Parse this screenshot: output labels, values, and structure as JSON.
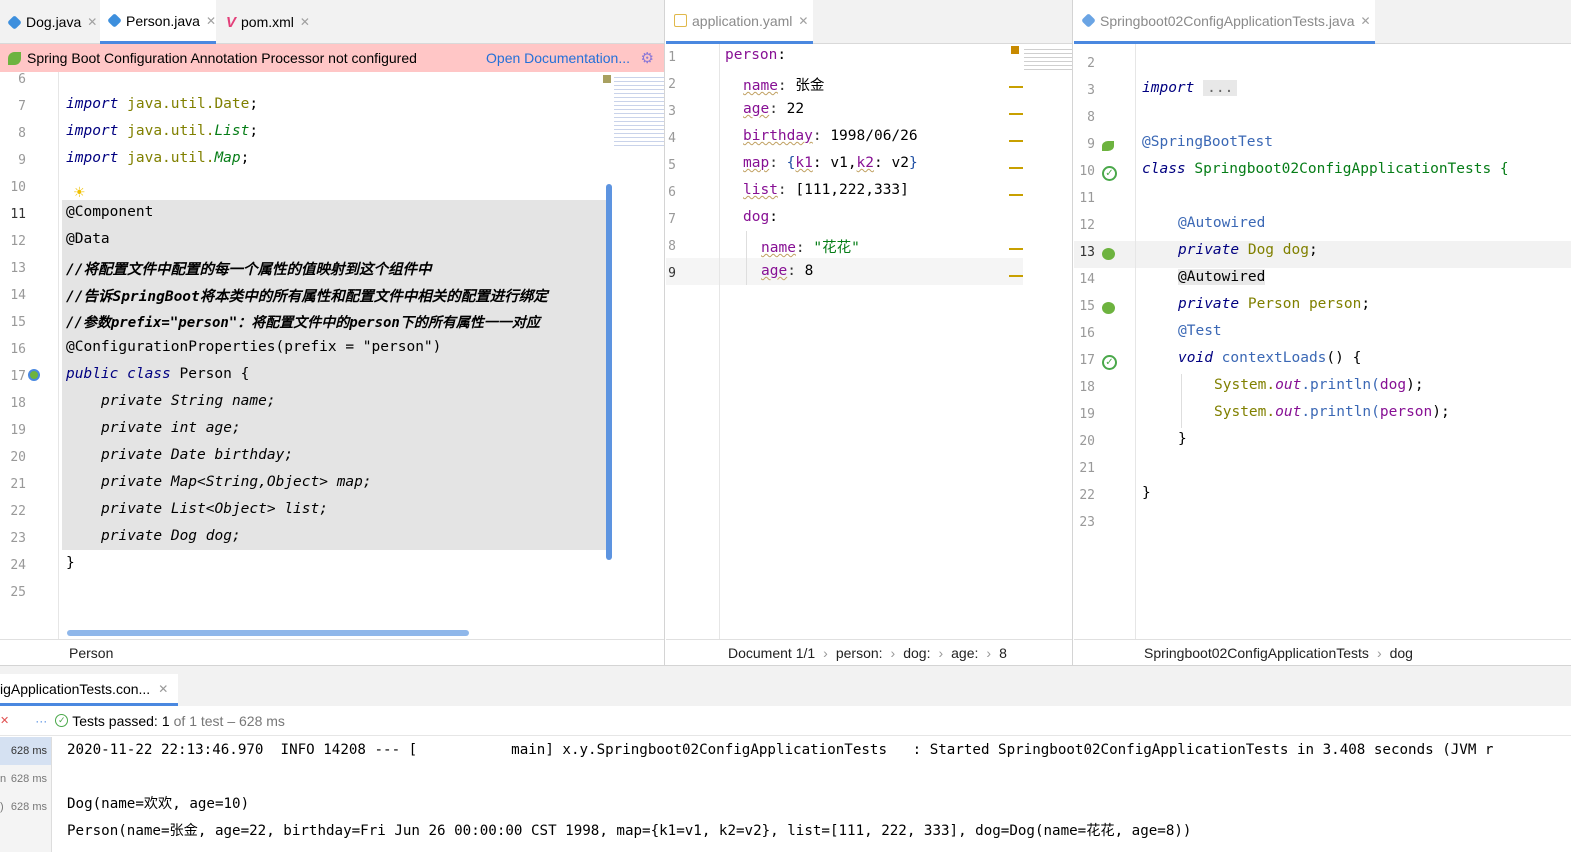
{
  "left_pane": {
    "tabs": [
      {
        "label": "Dog.java",
        "icon": "java-class-icon",
        "active": false
      },
      {
        "label": "Person.java",
        "icon": "java-class-icon",
        "active": true
      },
      {
        "label": "pom.xml",
        "icon": "maven-icon",
        "active": false
      }
    ],
    "banner": {
      "message": "Spring Boot Configuration Annotation Processor not configured",
      "link": "Open Documentation...",
      "color": "#ffc6c6"
    },
    "line_numbers": [
      "6",
      "7",
      "8",
      "9",
      "10",
      "11",
      "12",
      "13",
      "14",
      "15",
      "16",
      "17",
      "18",
      "19",
      "20",
      "21",
      "22",
      "23",
      "24",
      "25"
    ],
    "code": {
      "l7_kw": "import",
      "l7_pkg": "java.util.",
      "l7_cls": "Date",
      "l7_end": ";",
      "l8_kw": "import",
      "l8_pkg": "java.util.",
      "l8_cls": "List",
      "l8_end": ";",
      "l9_kw": "import",
      "l9_pkg": "java.util.",
      "l9_cls": "Map",
      "l9_end": ";",
      "l11": "@Component",
      "l12": "@Data",
      "l13": "//将配置文件中配置的每一个属性的值映射到这个组件中",
      "l14": "//告诉SpringBoot将本类中的所有属性和配置文件中相关的配置进行绑定",
      "l15": "//参数prefix=\"person\"：将配置文件中的person下的所有属性一一对应",
      "l16": "@ConfigurationProperties(prefix = \"person\")",
      "l17_kw": "public class",
      "l17_name": " Person {",
      "l18": "private String name;",
      "l19": "private int age;",
      "l20": "private Date birthday;",
      "l21": "private Map<String,Object> map;",
      "l22": "private List<Object> list;",
      "l23": "private Dog dog;",
      "l24": "}"
    },
    "breadcrumb": "Person"
  },
  "mid_pane": {
    "tab": {
      "label": "application.yaml",
      "icon": "yaml-icon"
    },
    "line_numbers": [
      "1",
      "2",
      "3",
      "4",
      "5",
      "6",
      "7",
      "8",
      "9"
    ],
    "yaml": {
      "person": "person",
      "name_k": "name",
      "name_v": "张金",
      "age_k": "age",
      "age_v": "22",
      "birthday_k": "birthday",
      "birthday_v": "1998/06/26",
      "map_k": "map",
      "map_v1k": "k1",
      "map_v1v": "v1",
      "map_v2k": "k2",
      "map_v2v": "v2",
      "list_k": "list",
      "list_v": "[111,222,333]",
      "dog_k": "dog",
      "dog_name_k": "name",
      "dog_name_v": "\"花花\"",
      "dog_age_k": "age",
      "dog_age_v": "8"
    },
    "breadcrumbs": [
      "Document 1/1",
      "person:",
      "dog:",
      "age:",
      "8"
    ]
  },
  "right_pane": {
    "tab": {
      "label": "Springboot02ConfigApplicationTests.java",
      "icon": "java-class-icon"
    },
    "line_numbers": [
      "2",
      "3",
      "8",
      "9",
      "10",
      "11",
      "12",
      "13",
      "14",
      "15",
      "16",
      "17",
      "18",
      "19",
      "20",
      "21",
      "22",
      "23"
    ],
    "code": {
      "l3_kw": "import",
      "l3_fold": "...",
      "l9": "@SpringBootTest",
      "l10_kw": "class",
      "l10_name": " Springboot02ConfigApplicationTests {",
      "l12": "@Autowired",
      "l13_kw": "private",
      "l13_type": " Dog ",
      "l13_field": "dog",
      "l13_end": ";",
      "l14": "@Autowired",
      "l15_kw": "private",
      "l15_type": " Person ",
      "l15_field": "person",
      "l15_end": ";",
      "l16": "@Test",
      "l17_kw": "void",
      "l17_name": " contextLoads",
      "l17_end": "() {",
      "l18_a": "System.",
      "l18_b": "out",
      "l18_c": ".println(",
      "l18_d": "dog",
      "l18_e": ");",
      "l19_a": "System.",
      "l19_b": "out",
      "l19_c": ".println(",
      "l19_d": "person",
      "l19_e": ");",
      "l20": "}",
      "l22": "}"
    },
    "breadcrumbs": [
      "Springboot02ConfigApplicationTests",
      "dog"
    ]
  },
  "run_panel": {
    "tab_label": "igApplicationTests.con...",
    "tests_passed_label": "Tests passed:",
    "tests_passed_count": "1",
    "tests_passed_rest": "of 1 test – 628 ms",
    "tree_rows": [
      "628 ms",
      "628 ms",
      "628 ms"
    ],
    "tree_prefixes": [
      "",
      "n",
      ")"
    ],
    "console_lines": [
      "2020-11-22 22:13:46.970  INFO 14208 --- [           main] x.y.Springboot02ConfigApplicationTests   : Started Springboot02ConfigApplicationTests in 3.408 seconds (JVM r",
      "",
      "Dog(name=欢欢, age=10)",
      "Person(name=张金, age=22, birthday=Fri Jun 26 00:00:00 CST 1998, map={k1=v1, k2=v2}, list=[111, 222, 333], dog=Dog(name=花花, age=8))"
    ]
  },
  "colors": {
    "accent": "#4a88e0",
    "keyword": "#000080",
    "annotation": "#808000",
    "string": "#067d17",
    "field": "#871094",
    "banner": "#ffc6c6"
  }
}
